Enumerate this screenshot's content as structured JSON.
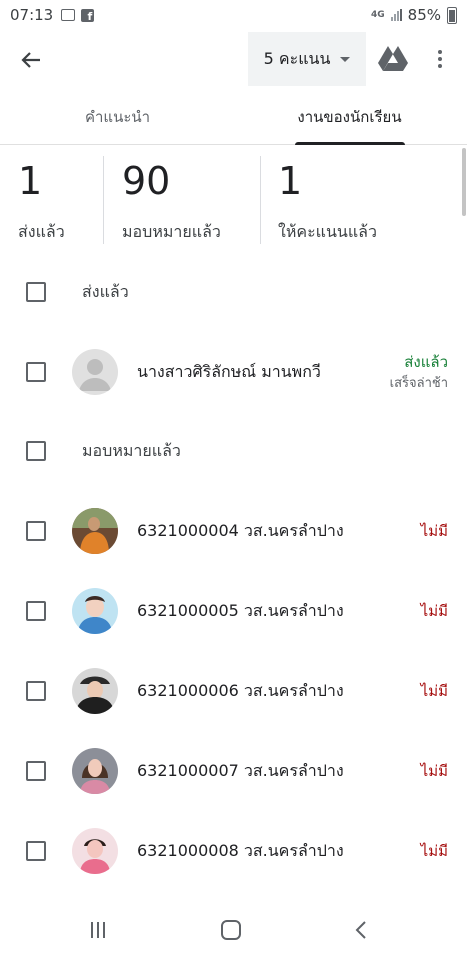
{
  "status_bar": {
    "time": "07:13",
    "network": "4G",
    "battery": "85%"
  },
  "app_bar": {
    "points_label": "5 คะแนน"
  },
  "tabs": [
    {
      "label": "คำแนะนำ",
      "active": false
    },
    {
      "label": "งานของนักเรียน",
      "active": true
    }
  ],
  "stats": [
    {
      "value": "1",
      "label": "ส่งแล้ว"
    },
    {
      "value": "90",
      "label": "มอบหมายแล้ว"
    },
    {
      "value": "1",
      "label": "ให้คะแนนแล้ว"
    }
  ],
  "sections": {
    "turned_in": "ส่งแล้ว",
    "assigned": "มอบหมายแล้ว"
  },
  "turned_in_students": [
    {
      "name": "นางสาวศิริลักษณ์ มานพกวี",
      "status": "ส่งแล้ว",
      "note": "เสร็จล่าช้า"
    }
  ],
  "assigned_students": [
    {
      "name": "6321000004 วส.นครลำปาง",
      "status": "ไม่มี"
    },
    {
      "name": "6321000005 วส.นครลำปาง",
      "status": "ไม่มี"
    },
    {
      "name": "6321000006 วส.นครลำปาง",
      "status": "ไม่มี"
    },
    {
      "name": "6321000007 วส.นครลำปาง",
      "status": "ไม่มี"
    },
    {
      "name": "6321000008 วส.นครลำปาง",
      "status": "ไม่มี"
    }
  ],
  "colors": {
    "turned_in": "#188038",
    "missing": "#a50e0e",
    "text": "#202124"
  }
}
